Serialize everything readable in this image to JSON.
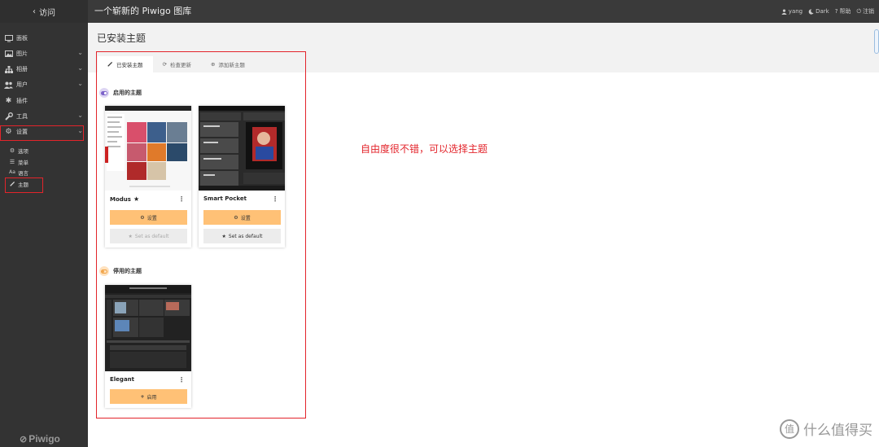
{
  "topbar": {
    "back_label": "访问",
    "gallery_title": "一个崭新的 Piwigo 图库",
    "user": "yang",
    "theme_toggle": "Dark",
    "help": "帮助",
    "logout": "注销"
  },
  "sidebar": {
    "items": [
      {
        "label": "面板",
        "icon": "monitor-icon"
      },
      {
        "label": "图片",
        "icon": "image-icon"
      },
      {
        "label": "相册",
        "icon": "sitemap-icon"
      },
      {
        "label": "用户",
        "icon": "users-icon"
      },
      {
        "label": "插件",
        "icon": "puzzle-icon"
      },
      {
        "label": "工具",
        "icon": "wrench-icon"
      },
      {
        "label": "设置",
        "icon": "gear-icon"
      }
    ],
    "sub_items": [
      {
        "label": "选项",
        "icon": "cogs-icon"
      },
      {
        "label": "菜单",
        "icon": "list-icon"
      },
      {
        "label": "语言",
        "icon": "font-icon"
      },
      {
        "label": "主题",
        "icon": "brush-icon"
      }
    ],
    "logo": "Piwigo"
  },
  "main": {
    "title": "已安装主题",
    "tabs": [
      {
        "label": "已安装主题",
        "icon": "brush-icon"
      },
      {
        "label": "检查更新",
        "icon": "refresh-icon"
      },
      {
        "label": "添加新主题",
        "icon": "plus-circle-icon"
      }
    ],
    "enabled_section": "启用的主题",
    "disabled_section": "停用的主题",
    "themes": {
      "modus": {
        "name": "Modus",
        "settings": "设置",
        "default": "Set as default"
      },
      "smart_pocket": {
        "name": "Smart Pocket",
        "settings": "设置",
        "default": "Set as default"
      },
      "elegant": {
        "name": "Elegant",
        "enable": "启用"
      }
    },
    "annotation": "自由度很不错，可以选择主题"
  },
  "watermark": "什么值得买",
  "colors": {
    "accent_orange": "#ffc176",
    "highlight_red": "#e3242b",
    "sidebar": "#333333",
    "topbar": "#3a3a3a"
  }
}
